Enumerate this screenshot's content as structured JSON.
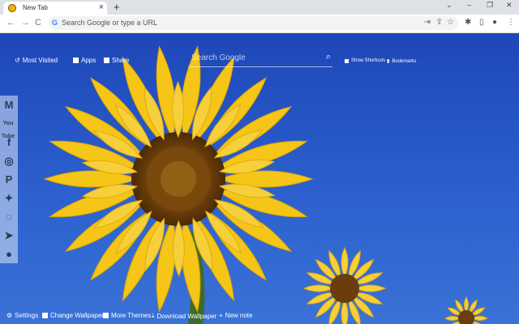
{
  "tab": {
    "title": "New Tab",
    "close": "×",
    "new_tab": "+"
  },
  "window": {
    "minimize": "–",
    "restore": "❐",
    "close": "✕",
    "menu": "⌄"
  },
  "toolbar": {
    "back": "←",
    "forward": "→",
    "reload": "C",
    "placeholder": "Search Google or type a URL",
    "google_g": "G"
  },
  "topmenu": {
    "most_visited": "Most Visited",
    "apps": "Apps",
    "share": "Share",
    "show_shortcuts": "Show Shortcuts",
    "bookmarks": "Bookmarks"
  },
  "search": {
    "placeholder": "Search Google"
  },
  "sidebar": {
    "items": [
      "gmail-icon",
      "youtube-icon",
      "facebook-icon",
      "instagram-icon",
      "pinterest-icon",
      "twitter-icon",
      "whatsapp-icon",
      "telegram-icon",
      "reddit-icon"
    ],
    "youtube_text": "You Tube"
  },
  "bottombar": {
    "settings": "Settings",
    "change_wallpaper": "Change Wallpaper",
    "more_themes": "More Themes",
    "download_wallpaper": "Download Wallpaper",
    "new_note": "New note"
  },
  "colors": {
    "sky": "#2a5ec9",
    "petal": "#f5c518",
    "center": "#6b3d0a"
  }
}
